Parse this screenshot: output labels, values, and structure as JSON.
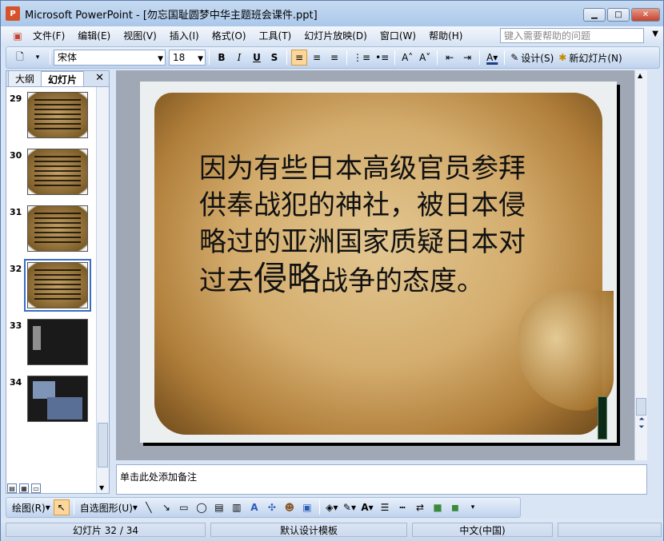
{
  "window": {
    "title": "Microsoft PowerPoint - [勿忘国耻圆梦中华主题班会课件.ppt]",
    "app_icon": "powerpoint-icon",
    "controls": [
      "minimize",
      "maximize",
      "close"
    ]
  },
  "menu": {
    "items": [
      "文件(F)",
      "编辑(E)",
      "视图(V)",
      "插入(I)",
      "格式(O)",
      "工具(T)",
      "幻灯片放映(D)",
      "窗口(W)",
      "帮助(H)"
    ],
    "help_placeholder": "键入需要帮助的问题"
  },
  "toolbar": {
    "font_name": "宋体",
    "font_size": "18",
    "bold": "B",
    "italic": "I",
    "underline": "U",
    "shadow": "S",
    "design_label": "设计(S)",
    "new_slide_label": "新幻灯片(N)"
  },
  "panel": {
    "tabs": [
      "大纲",
      "幻灯片"
    ],
    "selected_tab": "幻灯片",
    "slides": [
      {
        "num": "29",
        "style": "paper"
      },
      {
        "num": "30",
        "style": "paper"
      },
      {
        "num": "31",
        "style": "paper"
      },
      {
        "num": "32",
        "style": "paper",
        "selected": true
      },
      {
        "num": "33",
        "style": "dark"
      },
      {
        "num": "34",
        "style": "dark"
      }
    ]
  },
  "slide": {
    "text_line1": "因为有些日本高级官员参拜",
    "text_line2": "供奉战犯的神社，被日本侵",
    "text_line3": "略过的亚洲国家质疑日本对",
    "text_line4_a": "过去",
    "text_line4_big": "侵略",
    "text_line4_b": "战争的态度。"
  },
  "notes": {
    "placeholder": "单击此处添加备注"
  },
  "drawbar": {
    "draw_label": "绘图(R)",
    "autoshapes_label": "自选图形(U)"
  },
  "status": {
    "slide_position": "幻灯片 32 / 34",
    "template": "默认设计模板",
    "language": "中文(中国)"
  }
}
